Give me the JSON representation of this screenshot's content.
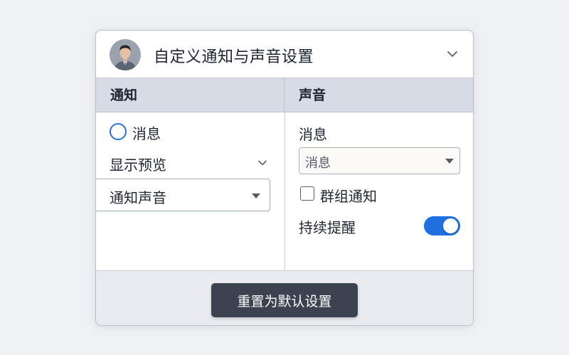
{
  "header": {
    "title": "自定义通知与声音设置",
    "avatar_icon": "user-avatar",
    "collapse_icon": "chevron-down-icon"
  },
  "left": {
    "heading": "通知",
    "radio_label": "消息",
    "preview_label": "显示预览",
    "sound_select_value": "通知声音"
  },
  "right": {
    "heading": "声音",
    "message_label": "消息",
    "message_select_value": "消息",
    "group_checkbox_label": "群组通知",
    "group_checked": false,
    "persistent_label": "持续提醒",
    "persistent_on": true
  },
  "footer": {
    "reset_label": "重置为默认设置"
  },
  "colors": {
    "accent": "#1f6fe0",
    "header_band": "#d6dbe6",
    "button": "#3b4250"
  }
}
